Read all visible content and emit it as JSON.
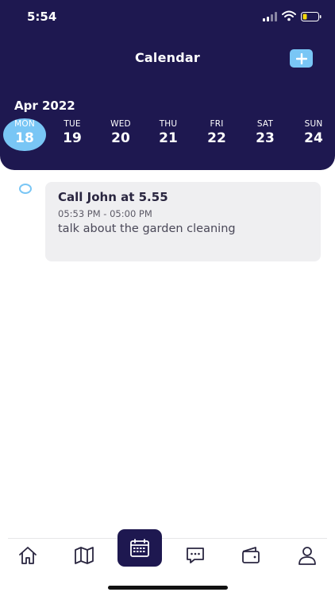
{
  "status_bar": {
    "time": "5:54"
  },
  "header": {
    "title": "Calendar",
    "month": "Apr 2022"
  },
  "days": [
    {
      "name": "MON",
      "num": "18"
    },
    {
      "name": "TUE",
      "num": "19"
    },
    {
      "name": "WED",
      "num": "20"
    },
    {
      "name": "THU",
      "num": "21"
    },
    {
      "name": "FRI",
      "num": "22"
    },
    {
      "name": "SAT",
      "num": "23"
    },
    {
      "name": "SUN",
      "num": "24"
    }
  ],
  "event": {
    "title": "Call John at 5.55",
    "time": "05:53 PM - 05:00 PM",
    "description": "talk about the garden cleaning"
  },
  "nav": [
    "home-icon",
    "map-icon",
    "calendar-icon",
    "chat-icon",
    "wallet-icon",
    "profile-icon"
  ],
  "colors": {
    "primary": "#1e1850",
    "accent": "#79c6f5",
    "card": "#efeff1",
    "battery": "#f5d90a"
  }
}
